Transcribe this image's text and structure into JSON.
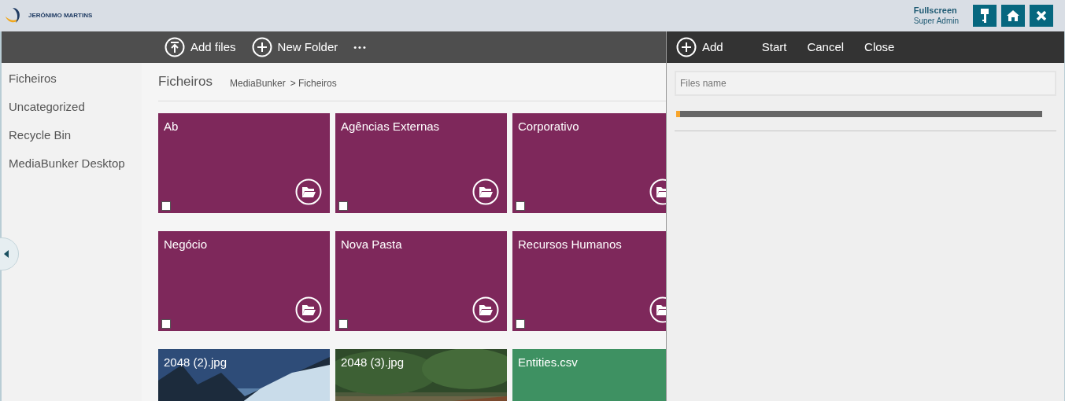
{
  "header": {
    "logo_text": "JERÓNIMO MARTINS",
    "user_title": "Fullscreen",
    "user_role": "Super Admin"
  },
  "toolbar": {
    "actions": [
      {
        "kind": "upload",
        "label": "Add files"
      },
      {
        "kind": "add",
        "label": "New Folder"
      },
      {
        "kind": "more",
        "label": "•••"
      }
    ]
  },
  "sidebar": {
    "items": [
      {
        "label": "Ficheiros"
      },
      {
        "label": "Uncategorized"
      },
      {
        "label": "Recycle Bin"
      },
      {
        "label": "MediaBunker Desktop"
      }
    ]
  },
  "content": {
    "title": "Ficheiros",
    "breadcrumb": [
      {
        "label": "MediaBunker"
      },
      {
        "label": "> Ficheiros"
      }
    ],
    "tiles": [
      {
        "kind": "folder",
        "name": "Ab",
        "checked": false
      },
      {
        "kind": "folder",
        "name": "Agências Externas",
        "checked": false
      },
      {
        "kind": "folder",
        "name": "Corporativo",
        "checked": false
      },
      {
        "kind": "folder",
        "name": "Negócio",
        "checked": false
      },
      {
        "kind": "folder",
        "name": "Nova Pasta",
        "checked": false
      },
      {
        "kind": "folder",
        "name": "Recursos Humanos",
        "checked": false
      },
      {
        "name": "2048 (2).jpg"
      },
      {
        "name": "2048 (3).jpg"
      },
      {
        "kind": "file",
        "name": "Entities.csv"
      }
    ]
  },
  "upload_panel": {
    "actions": [
      {
        "kind": "add",
        "label": "Add"
      },
      {
        "kind": "text",
        "label": "Start"
      },
      {
        "kind": "text",
        "label": "Cancel"
      },
      {
        "kind": "text",
        "label": "Close"
      }
    ],
    "files_name": {
      "placeholder": "Files name"
    },
    "progress": {
      "level": 0.01
    }
  }
}
